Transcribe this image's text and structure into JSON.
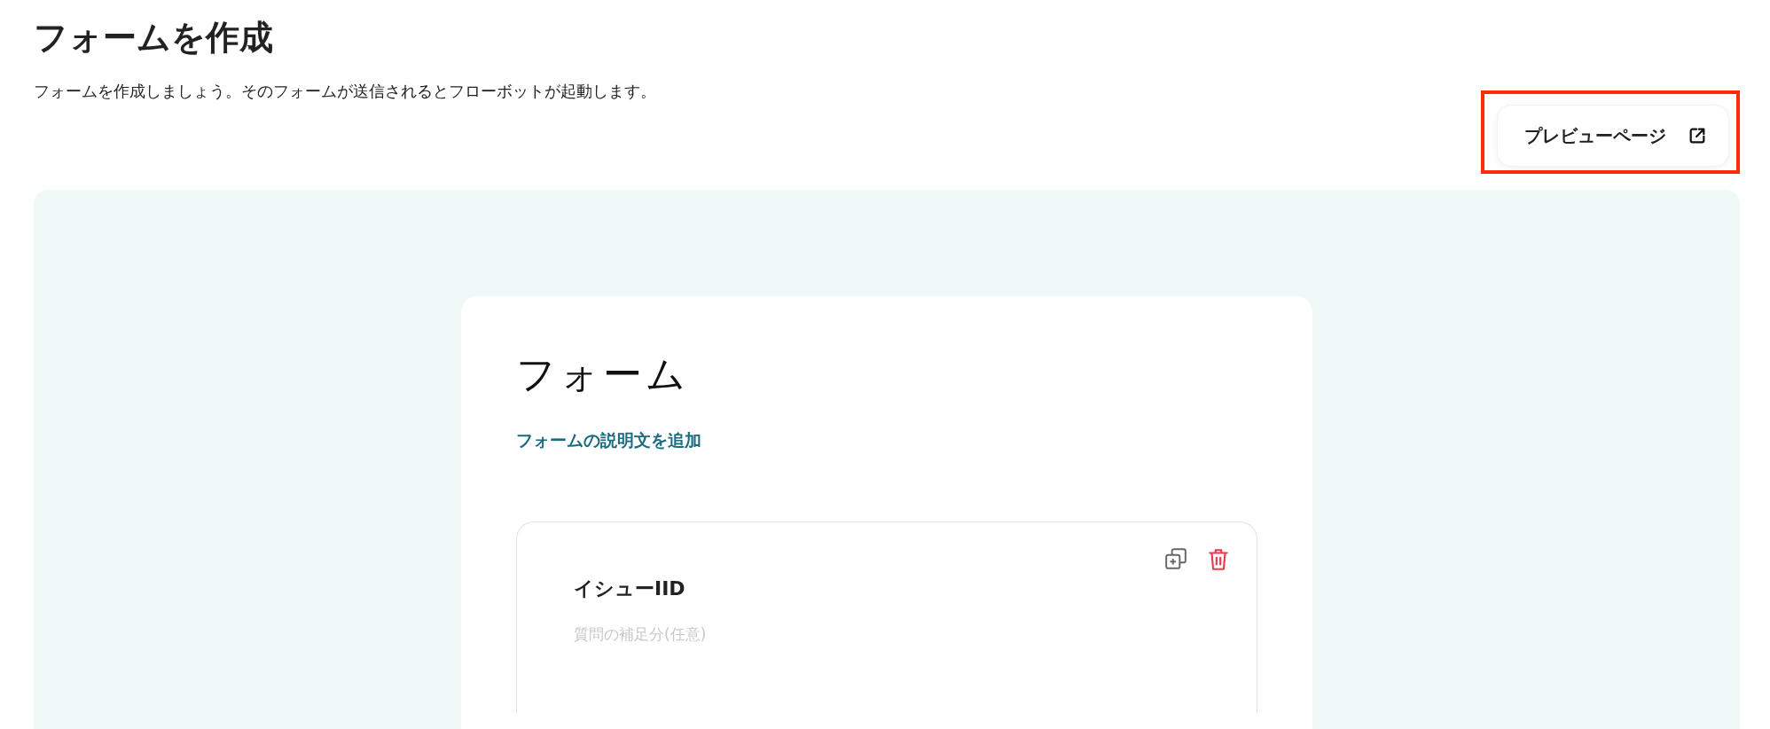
{
  "page": {
    "title": "フォームを作成",
    "description": "フォームを作成しましょう。そのフォームが送信されるとフローボットが起動します。"
  },
  "preview_button": {
    "label": "プレビューページ",
    "highlighted": true
  },
  "form": {
    "title": "フォーム",
    "add_description_link": "フォームの説明文を追加",
    "questions": [
      {
        "label": "イシューIID",
        "placeholder": "質問の補足分(任意)"
      }
    ]
  }
}
